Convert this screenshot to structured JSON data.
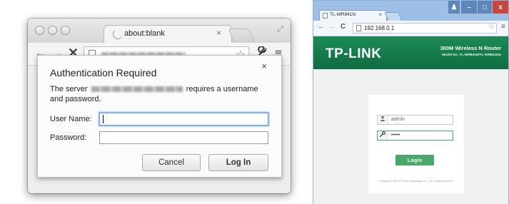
{
  "left_browser": {
    "tab_title": "about:blank",
    "tab_close": "×",
    "nav": {
      "back": "←",
      "forward": "→",
      "stop": "✕"
    },
    "star": "☆",
    "wrench": "🔧",
    "menu": "≡",
    "fullscreen": "⤢"
  },
  "auth_dialog": {
    "title": "Authentication Required",
    "close": "×",
    "message_prefix": "The server",
    "message_suffix": "requires a username and password.",
    "username_label": "User Name:",
    "username_value": "",
    "password_label": "Password:",
    "password_value": "",
    "cancel_label": "Cancel",
    "login_label": "Log In"
  },
  "right_browser": {
    "tab_title": "TL-WR841N",
    "tab_close": "×",
    "url": "192.168.0.1",
    "nav": {
      "back": "←",
      "forward": "→",
      "reload": "C"
    },
    "star": "☆",
    "menu": "≡",
    "window_controls": {
      "user": "♟",
      "minimize": "–",
      "maximize": "□",
      "close": "x"
    }
  },
  "tplink": {
    "logo": "TP-LINK",
    "model_title": "300M Wireless N Router",
    "model_subtitle": "Model No. TL-WR841N/TL-WR841ND",
    "username_value": "admin",
    "password_value": "•••••",
    "login_label": "Login",
    "copyright": "Copyright © 2013 TP-LINK Technologies Co., Ltd. All rights reserved."
  },
  "colors": {
    "tplink_green": "#1c8b57",
    "login_green": "#4aa96a",
    "focus_blue": "#6b9fe6",
    "win_tabstrip": "#9dbfe6",
    "win_close_red": "#c9463d"
  }
}
